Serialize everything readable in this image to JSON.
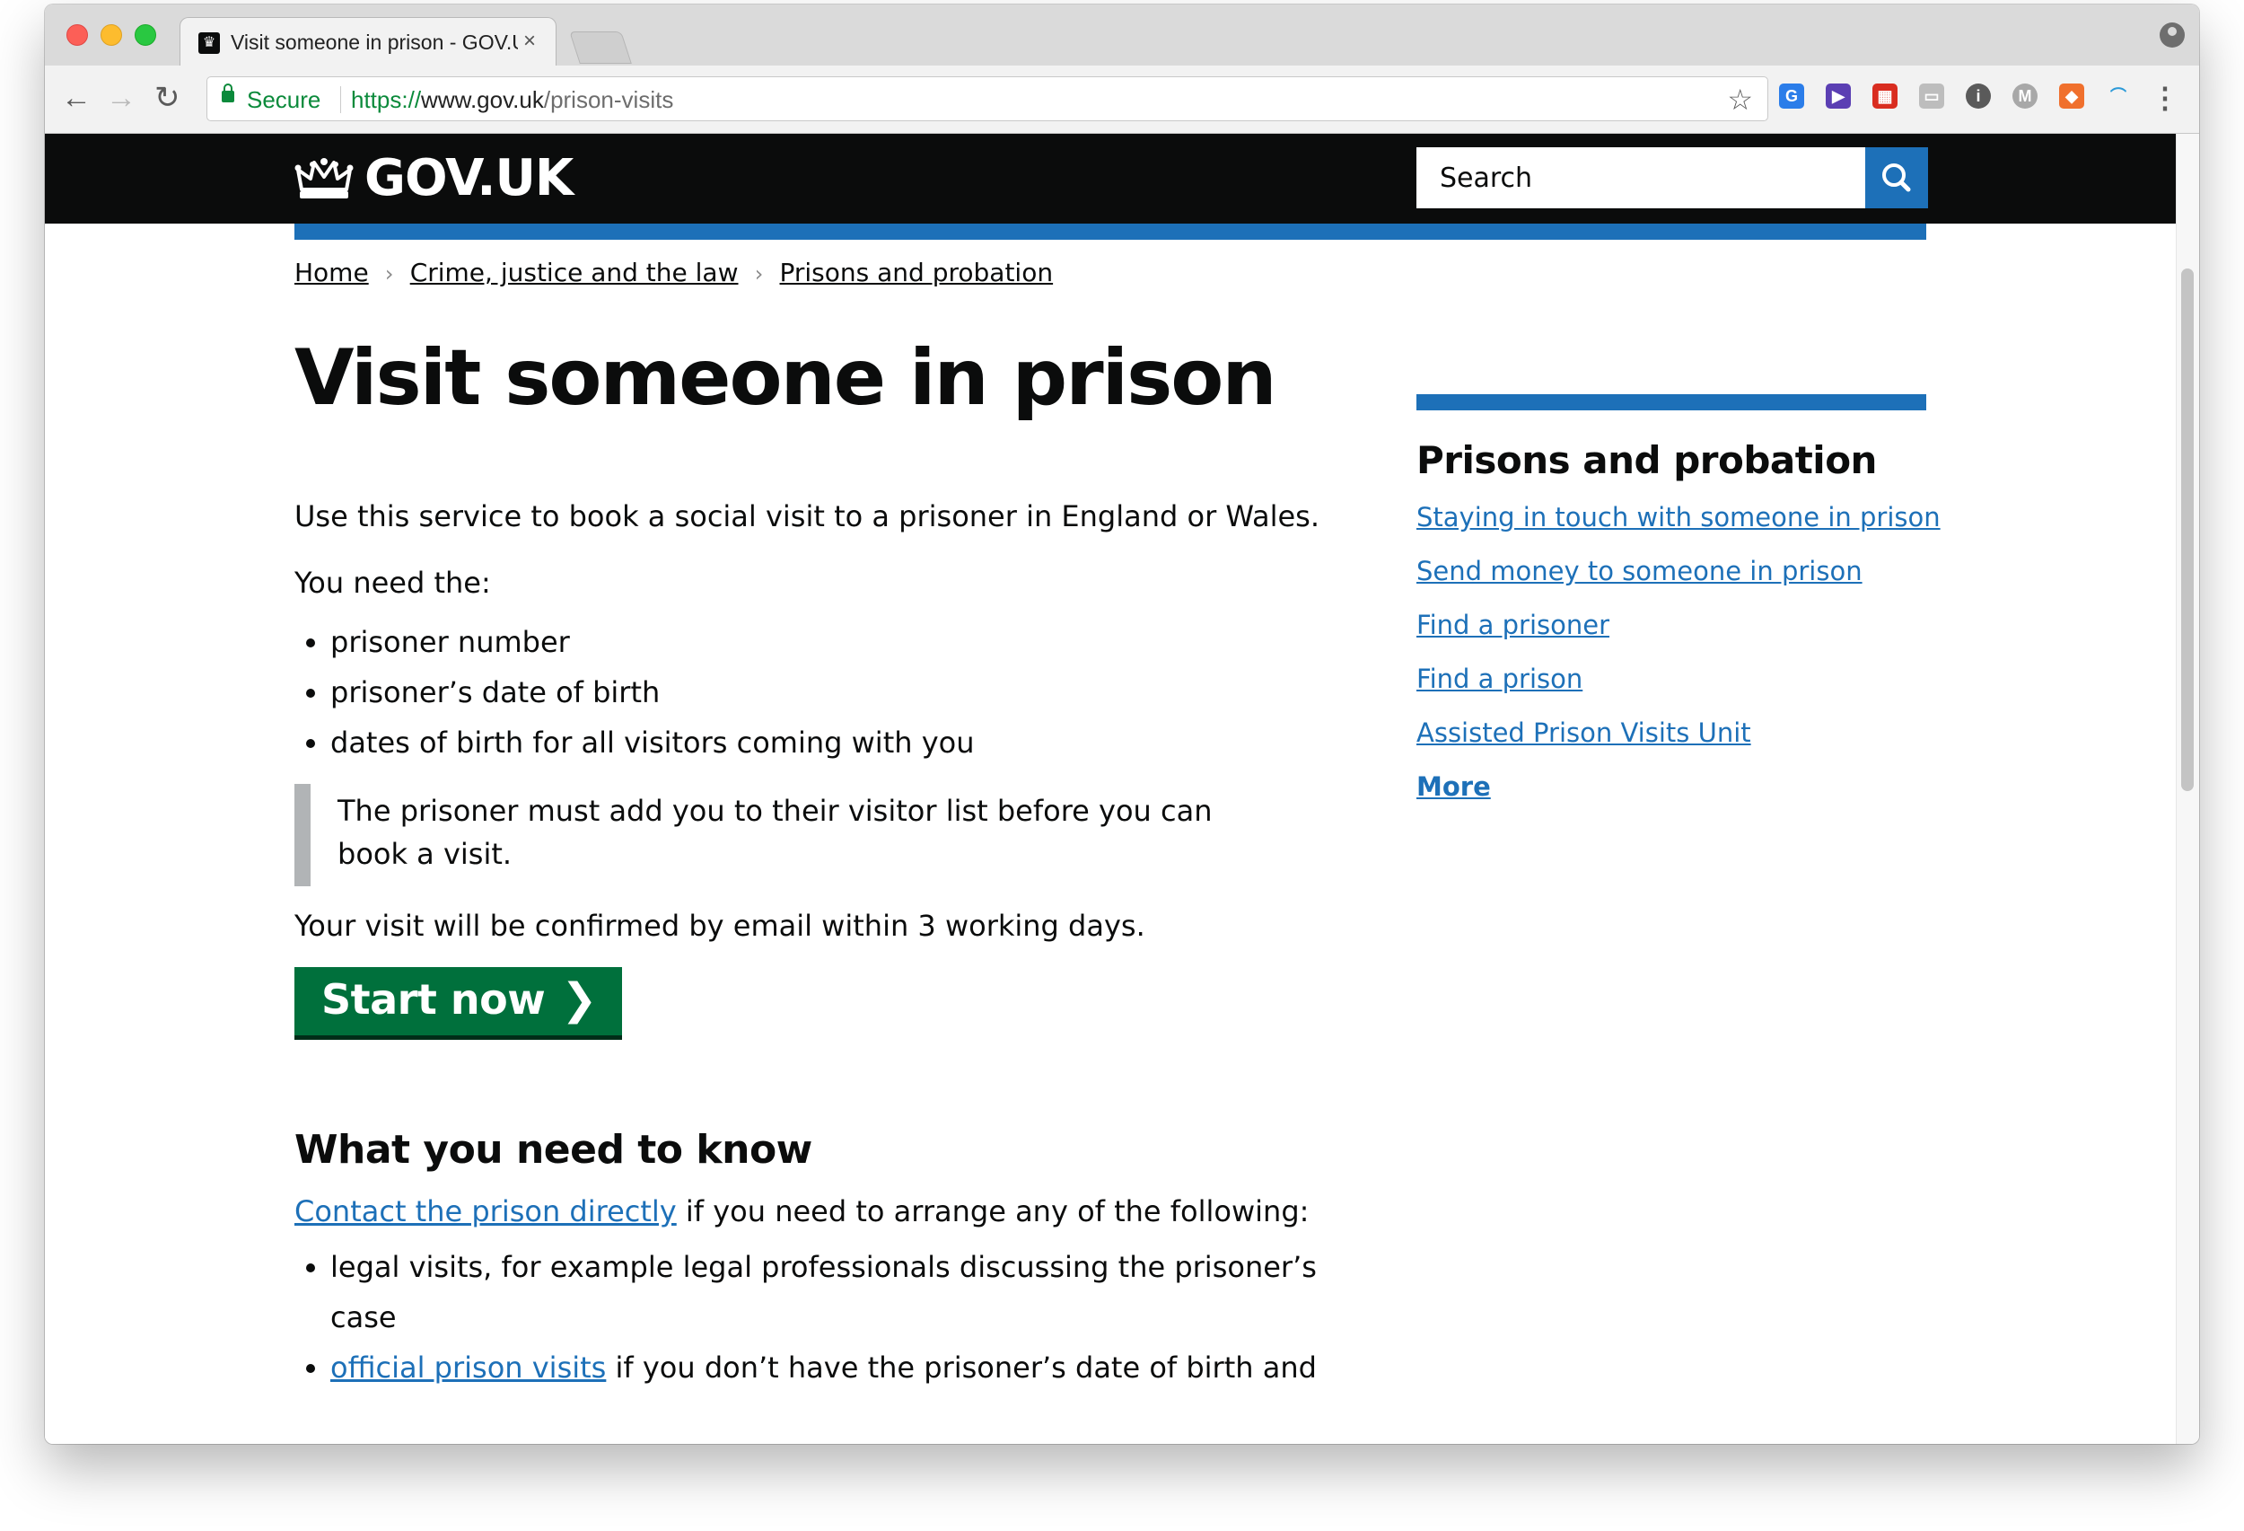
{
  "browser": {
    "tab_title": "Visit someone in prison - GOV.UK",
    "tab_close": "×",
    "secure_label": "Secure",
    "url_scheme": "https://",
    "url_host": "www.gov.uk",
    "url_path": "/prison-visits"
  },
  "header": {
    "logo_text": "GOV.UK",
    "search_placeholder": "Search"
  },
  "breadcrumbs": [
    "Home",
    "Crime, justice and the law",
    "Prisons and probation"
  ],
  "main": {
    "title": "Visit someone in prison",
    "intro": "Use this service to book a social visit to a prisoner in England or Wales.",
    "need_label": "You need the:",
    "needs": [
      "prisoner number",
      "prisoner’s date of birth",
      "dates of birth for all visitors coming with you"
    ],
    "inset": "The prisoner must add you to their visitor list before you can book a visit.",
    "confirmation": "Your visit will be confirmed by email within 3 working days.",
    "start_button": "Start now",
    "section_title": "What you need to know",
    "contact_link": "Contact the prison directly",
    "contact_text": " if you need to arrange any of the following:",
    "list2_item1": "legal visits, for example legal professionals discussing the prisoner’s case",
    "list2_item2_link": "official prison visits",
    "list2_item2_text": " if you don’t have the prisoner’s date of birth and"
  },
  "related": {
    "title": "Prisons and probation",
    "links": [
      "Staying in touch with someone in prison",
      "Send money to someone in prison",
      "Find a prisoner",
      "Find a prison",
      "Assisted Prison Visits Unit"
    ],
    "more": "More"
  },
  "colors": {
    "header_black": "#0b0c0c",
    "govuk_blue": "#1d70b8",
    "start_green": "#00703c",
    "secure_green": "#0b8a3b"
  }
}
